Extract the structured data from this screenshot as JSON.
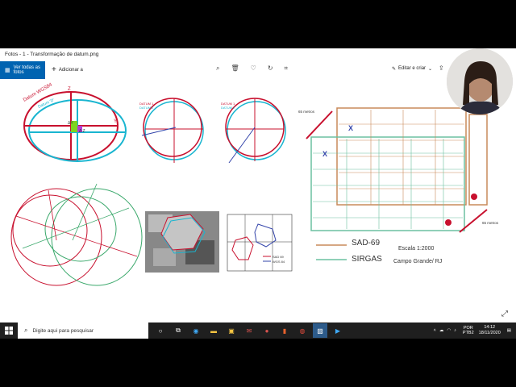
{
  "window": {
    "title": "Fotos - 1 - Transformação de datum.png"
  },
  "toolbar": {
    "see_all": "Ver todas as fotos",
    "add_to": "Adicionar a",
    "edit_create": "Editar e criar"
  },
  "diagram": {
    "ellipse_label_wgs": "Datum WGS84",
    "ellipse_label_sirgas": "Datum 'D'",
    "axis_z": "Z",
    "axis_y": "Y",
    "axis_x": "X",
    "delta_y": "ΔY",
    "delta_z": "Δ Z",
    "datum1": "DATUM 1",
    "datum2": "DATUM 2",
    "legend_sad": "SAD 69",
    "legend_wgs": "WGS 84",
    "meters_left": "65 metros",
    "meters_right": "65 metros",
    "map_legend_sad": "SAD-69",
    "map_legend_sirgas": "SIRGAS",
    "scale": "Escala 1:2000",
    "place": "Campo Grande/ RJ"
  },
  "taskbar": {
    "search_placeholder": "Digite aqui para pesquisar",
    "lang_line1": "POR",
    "lang_line2": "PTB2",
    "time": "14:12",
    "date": "18/11/2020"
  }
}
